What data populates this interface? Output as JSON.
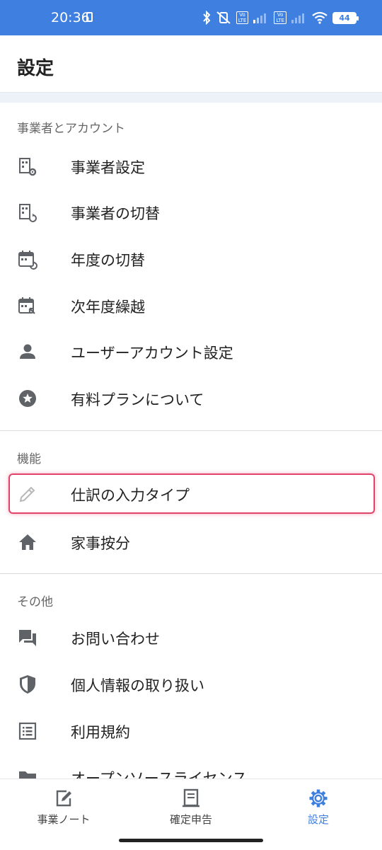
{
  "status_bar": {
    "time": "20:36",
    "battery": "44"
  },
  "header": {
    "title": "設定"
  },
  "sections": [
    {
      "header": "事業者とアカウント",
      "items": [
        {
          "label": "事業者設定",
          "icon": "building-gear-icon"
        },
        {
          "label": "事業者の切替",
          "icon": "building-switch-icon"
        },
        {
          "label": "年度の切替",
          "icon": "calendar-switch-icon"
        },
        {
          "label": "次年度繰越",
          "icon": "calendar-carry-icon"
        },
        {
          "label": "ユーザーアカウント設定",
          "icon": "person-icon"
        },
        {
          "label": "有料プランについて",
          "icon": "star-circle-icon"
        }
      ]
    },
    {
      "header": "機能",
      "items": [
        {
          "label": "仕訳の入力タイプ",
          "icon": "pencil-icon",
          "highlighted": true
        },
        {
          "label": "家事按分",
          "icon": "home-icon"
        }
      ]
    },
    {
      "header": "その他",
      "items": [
        {
          "label": "お問い合わせ",
          "icon": "chat-icon"
        },
        {
          "label": "個人情報の取り扱い",
          "icon": "shield-icon"
        },
        {
          "label": "利用規約",
          "icon": "list-doc-icon"
        },
        {
          "label": "オープンソースライセンス",
          "icon": "folder-icon"
        }
      ]
    }
  ],
  "bottom_nav": {
    "tabs": [
      {
        "label": "事業ノート",
        "icon": "note-edit-icon",
        "active": false
      },
      {
        "label": "確定申告",
        "icon": "receipt-icon",
        "active": false
      },
      {
        "label": "設定",
        "icon": "gear-icon",
        "active": true
      }
    ]
  },
  "colors": {
    "accent": "#3f7fe0",
    "highlight": "#e2436a",
    "icon_gray": "#5f6368"
  }
}
